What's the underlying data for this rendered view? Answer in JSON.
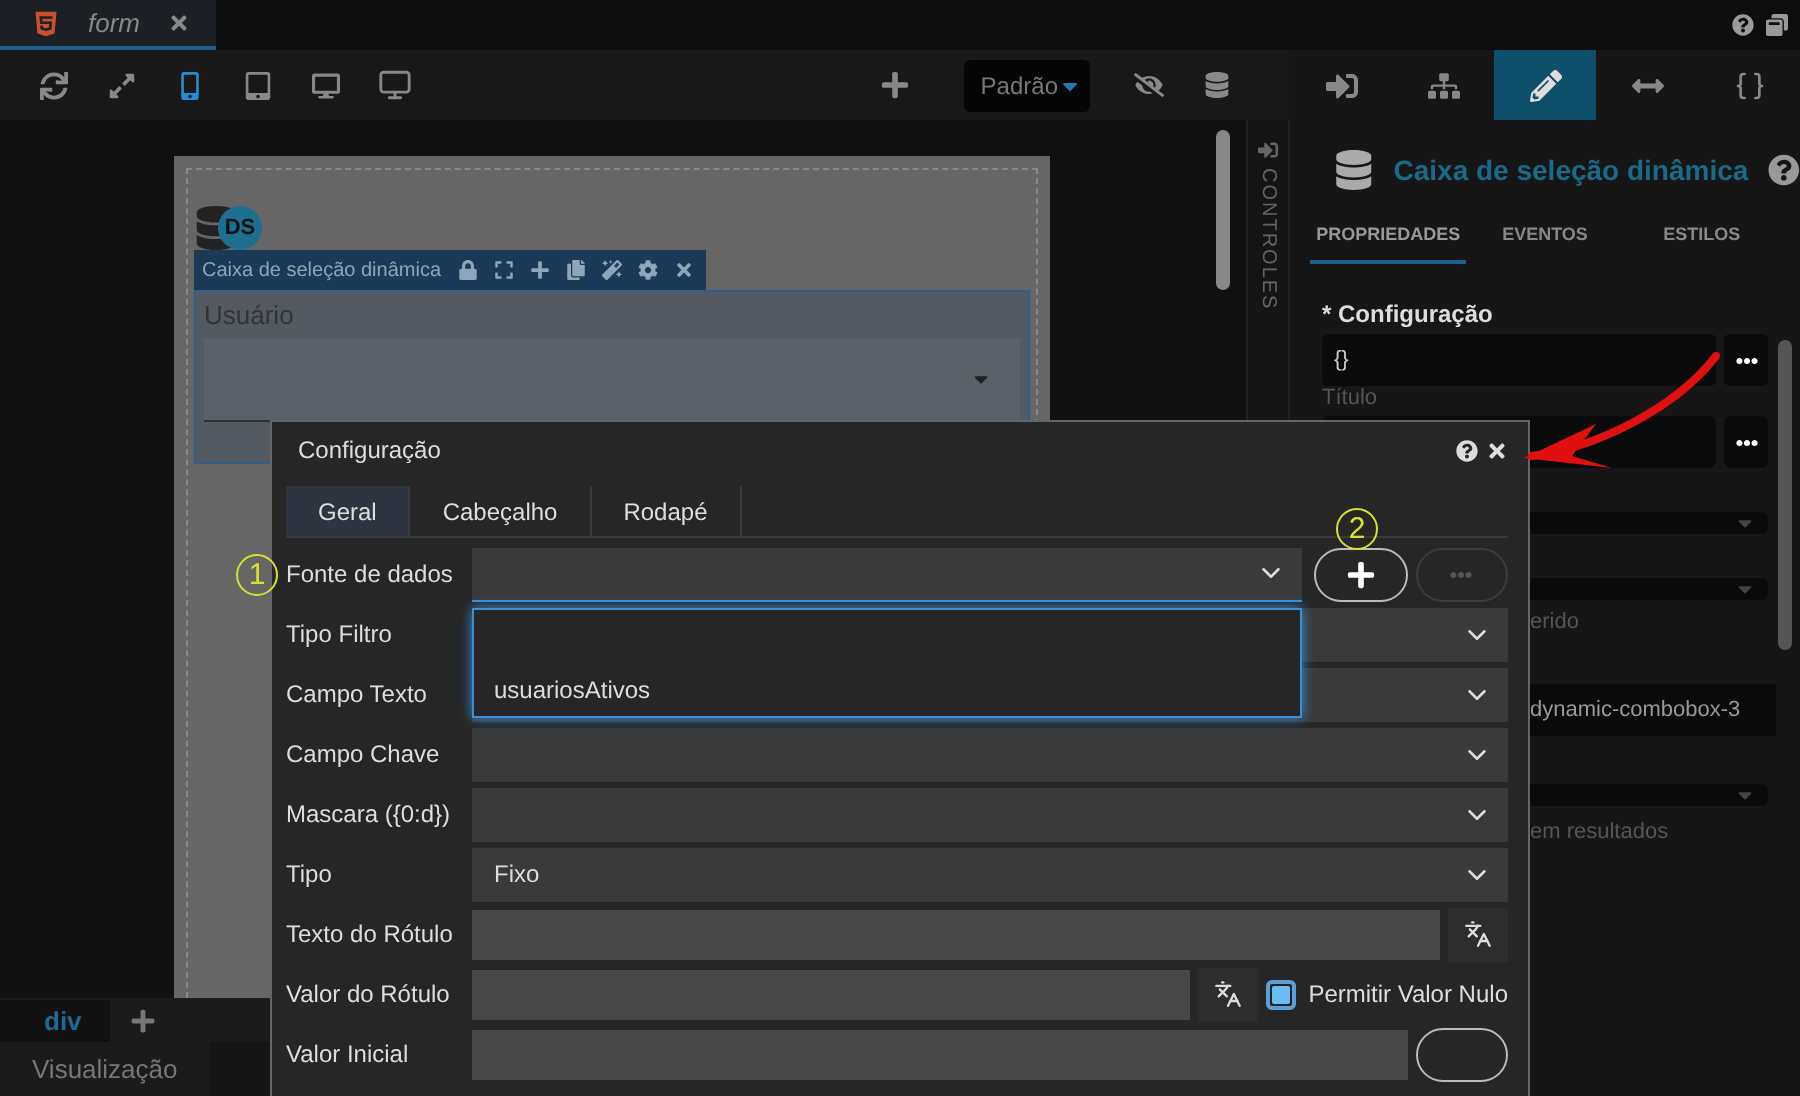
{
  "editor_tabs": [
    {
      "label": "form",
      "selected": true
    }
  ],
  "toolbar": {
    "devices": [
      {
        "kind": "refresh",
        "selected": false
      },
      {
        "kind": "expand",
        "selected": false
      },
      {
        "kind": "mobile",
        "selected": true
      },
      {
        "kind": "tablet",
        "selected": false
      },
      {
        "kind": "desktop",
        "selected": false
      },
      {
        "kind": "monitor",
        "selected": false
      }
    ],
    "profile_select": "Padrão"
  },
  "panel_tabs": [
    {
      "kind": "controls",
      "selected": false
    },
    {
      "kind": "tree",
      "selected": false
    },
    {
      "kind": "edit",
      "selected": true
    },
    {
      "kind": "resize",
      "selected": false
    },
    {
      "kind": "code",
      "selected": false
    }
  ],
  "canvas": {
    "datasource_badge": "DS",
    "component_title": "Caixa de seleção dinâmica",
    "field_label": "Usuário"
  },
  "side_strip": "CONTROLES",
  "properties": {
    "title": "Caixa de seleção dinâmica",
    "tabs": [
      {
        "label": "PROPRIEDADES",
        "selected": true
      },
      {
        "label": "EVENTOS",
        "selected": false
      },
      {
        "label": "ESTILOS",
        "selected": false
      }
    ],
    "config_label": "* Configuração",
    "config_value": "{}",
    "title_label": "Título",
    "hidden_fragments": [
      {
        "kind": "label",
        "text": "erido"
      },
      {
        "kind": "value",
        "text": "dynamic-combobox-3"
      },
      {
        "kind": "label",
        "text": "em resultados"
      }
    ]
  },
  "breadcrumb": "div",
  "bottom_tab": "Visualização",
  "modal": {
    "title": "Configuração",
    "tabs": [
      {
        "label": "Geral",
        "selected": true
      },
      {
        "label": "Cabeçalho",
        "selected": false
      },
      {
        "label": "Rodapé",
        "selected": false
      }
    ],
    "rows": [
      {
        "kind": "source",
        "label": "Fonte de dados",
        "expanded": true,
        "options": [
          "usuariosAtivos"
        ],
        "more_disabled": true
      },
      {
        "kind": "select",
        "label": "Tipo Filtro"
      },
      {
        "kind": "select",
        "label": "Campo Texto"
      },
      {
        "kind": "select",
        "label": "Campo Chave"
      },
      {
        "kind": "select",
        "label": "Mascara ({0:d})"
      },
      {
        "kind": "select",
        "label": "Tipo",
        "value": "Fixo"
      },
      {
        "kind": "text",
        "label": "Texto do Rótulo"
      },
      {
        "kind": "text",
        "label": "Valor do Rótulo",
        "checkbox": {
          "label": "Permitir Valor Nulo",
          "checked": true
        }
      },
      {
        "kind": "text_button",
        "label": "Valor Inicial"
      }
    ]
  },
  "annotations": [
    {
      "text": "1"
    },
    {
      "text": "2"
    }
  ]
}
